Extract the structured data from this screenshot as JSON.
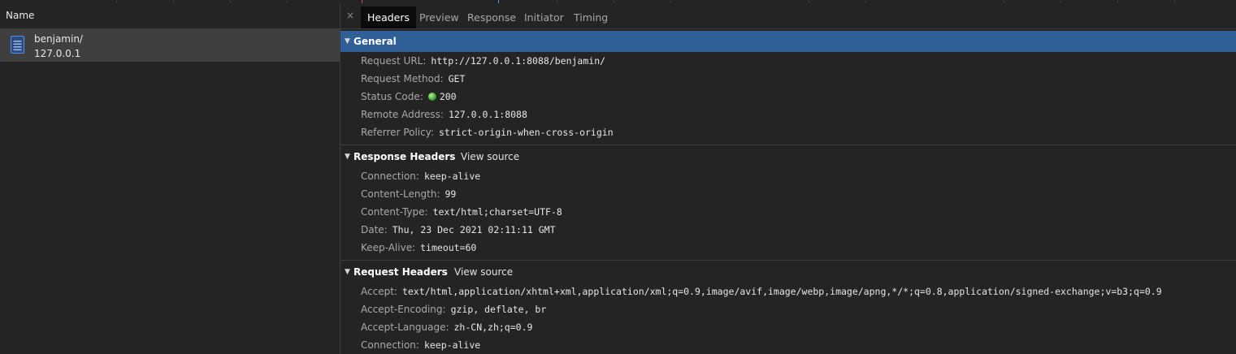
{
  "left_panel": {
    "column_header": "Name",
    "request": {
      "name": "benjamin/",
      "host": "127.0.0.1",
      "icon": "document-icon"
    }
  },
  "tabs": {
    "close_icon": "×",
    "items": [
      "Headers",
      "Preview",
      "Response",
      "Initiator",
      "Timing"
    ],
    "active": "Headers"
  },
  "general": {
    "title": "General",
    "rows": [
      {
        "k": "Request URL:",
        "v": "http://127.0.0.1:8088/benjamin/"
      },
      {
        "k": "Request Method:",
        "v": "GET"
      },
      {
        "k": "Status Code:",
        "v": "200"
      },
      {
        "k": "Remote Address:",
        "v": "127.0.0.1:8088"
      },
      {
        "k": "Referrer Policy:",
        "v": "strict-origin-when-cross-origin"
      }
    ]
  },
  "response_headers": {
    "title": "Response Headers",
    "view_source": "View source",
    "rows": [
      {
        "k": "Connection:",
        "v": "keep-alive"
      },
      {
        "k": "Content-Length:",
        "v": "99"
      },
      {
        "k": "Content-Type:",
        "v": "text/html;charset=UTF-8"
      },
      {
        "k": "Date:",
        "v": "Thu, 23 Dec 2021 02:11:11 GMT"
      },
      {
        "k": "Keep-Alive:",
        "v": "timeout=60"
      }
    ]
  },
  "request_headers": {
    "title": "Request Headers",
    "view_source": "View source",
    "rows": [
      {
        "k": "Accept:",
        "v": "text/html,application/xhtml+xml,application/xml;q=0.9,image/avif,image/webp,image/apng,*/*;q=0.8,application/signed-exchange;v=b3;q=0.9"
      },
      {
        "k": "Accept-Encoding:",
        "v": "gzip, deflate, br"
      },
      {
        "k": "Accept-Language:",
        "v": "zh-CN,zh;q=0.9"
      },
      {
        "k": "Connection:",
        "v": "keep-alive"
      }
    ]
  },
  "colors": {
    "selected_section": "#2f5f96",
    "status_ok": "#3aa52a",
    "doc_icon": "#4d8ef0"
  }
}
